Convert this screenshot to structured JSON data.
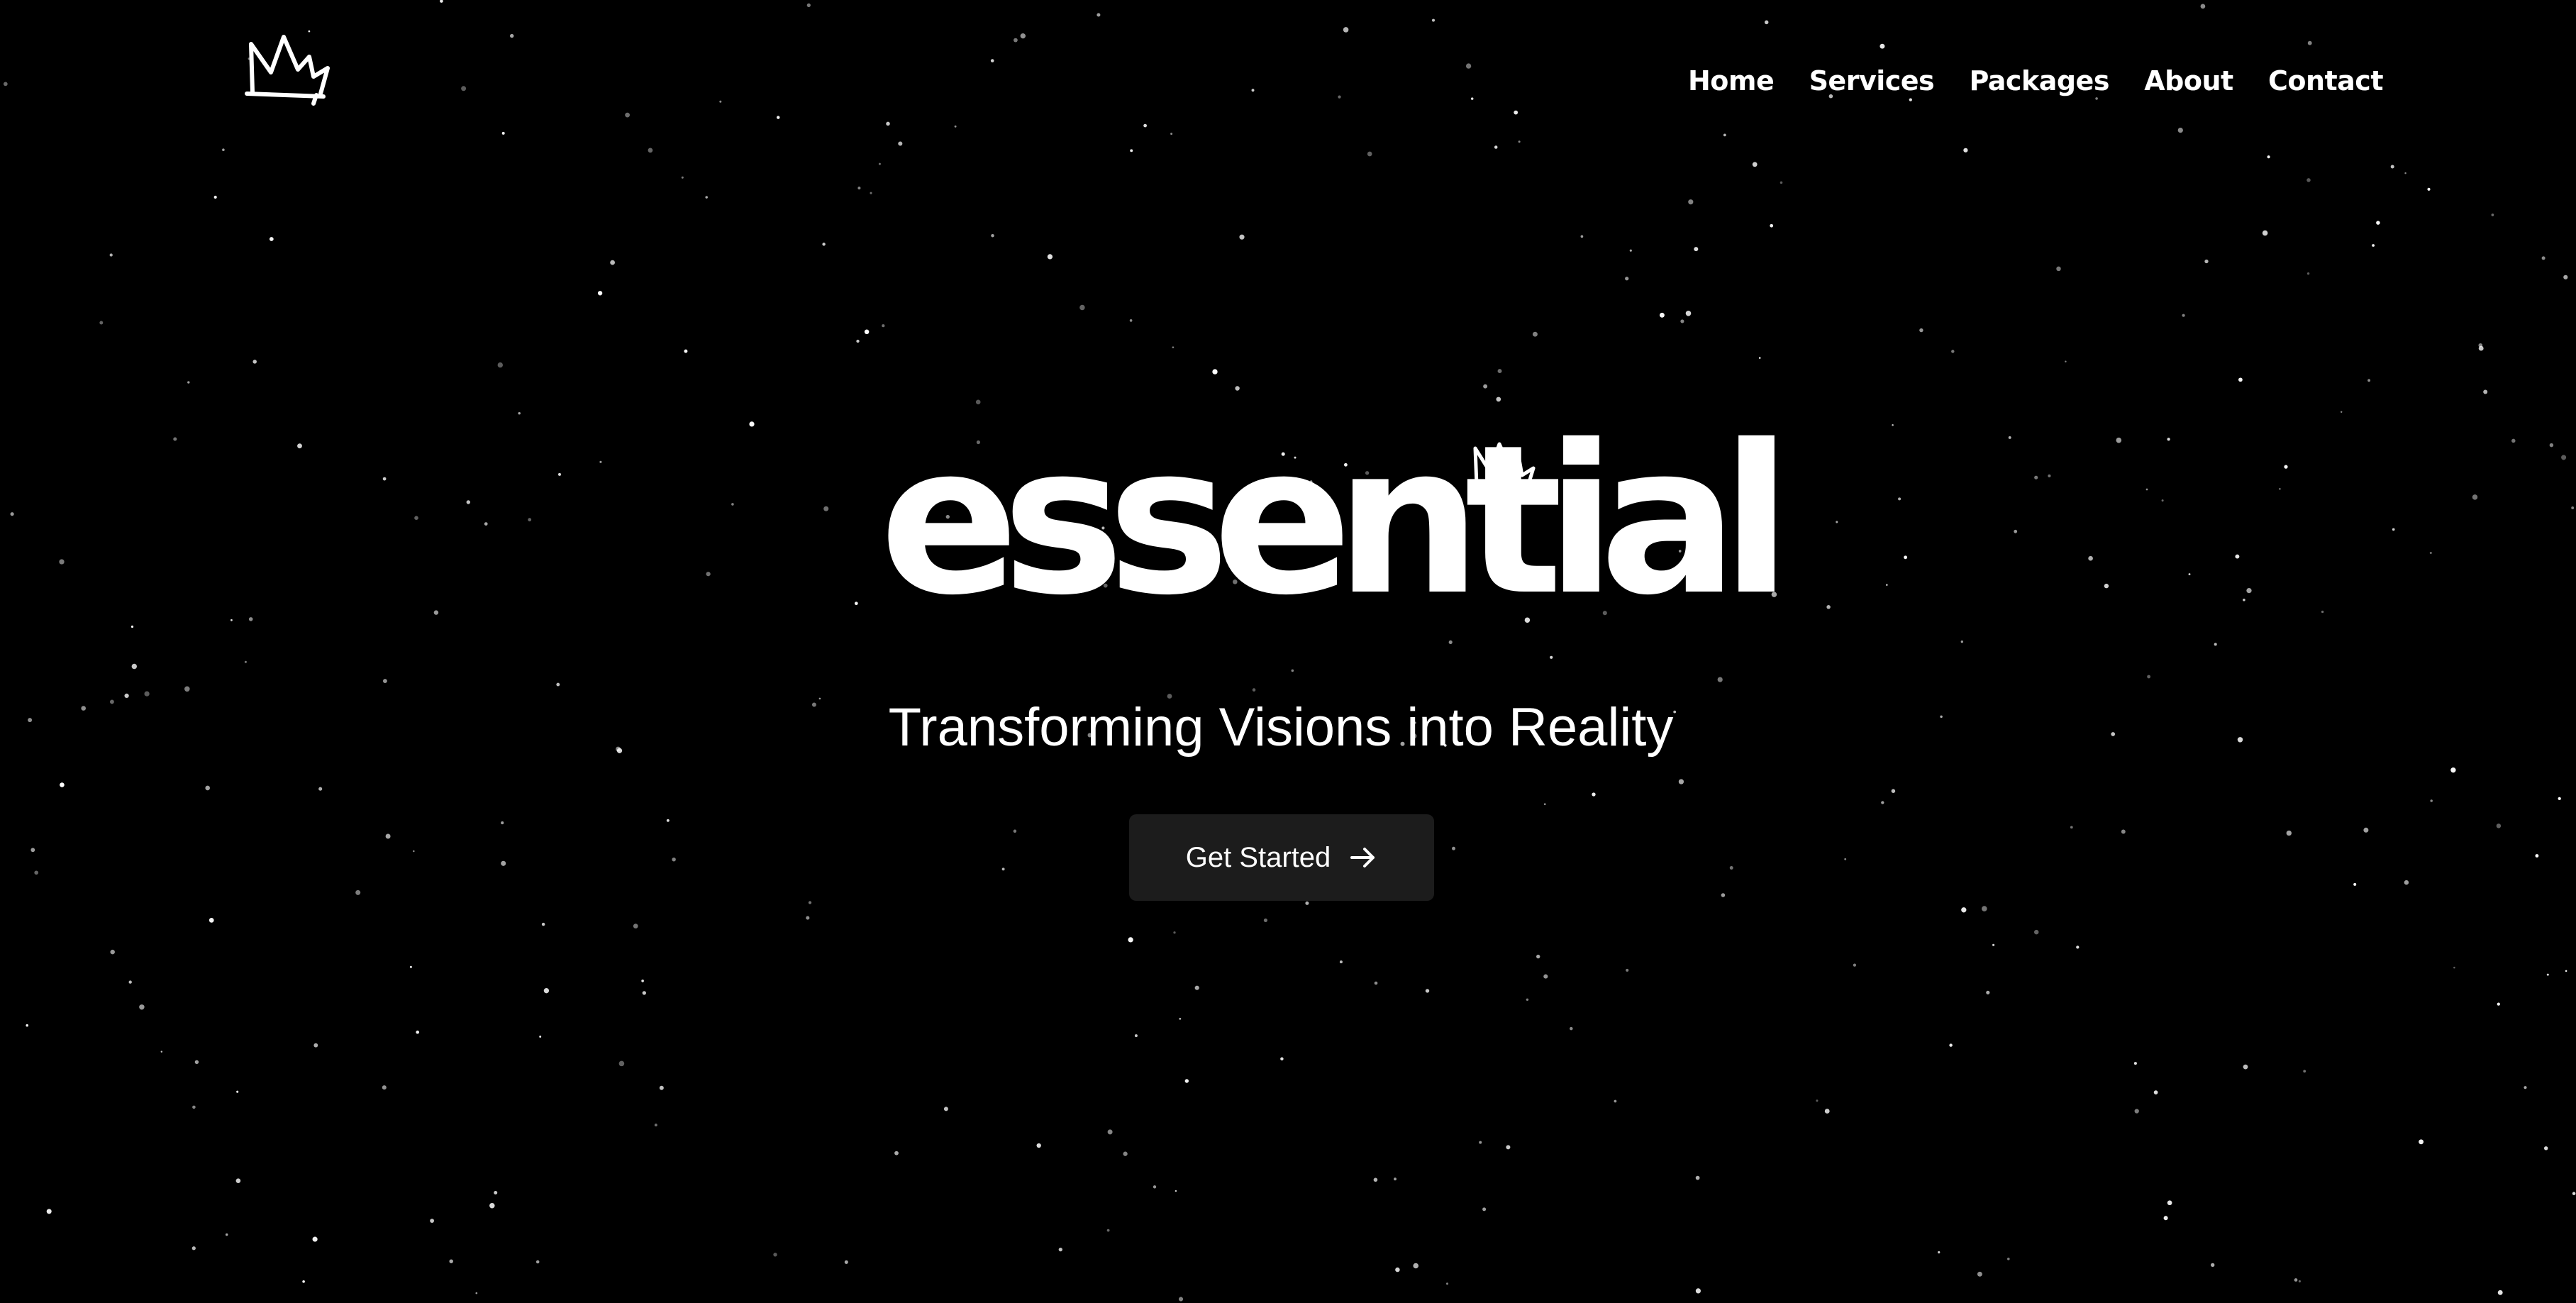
{
  "header": {
    "logo_icon": "crown-icon",
    "nav": [
      {
        "label": "Home"
      },
      {
        "label": "Services"
      },
      {
        "label": "Packages"
      },
      {
        "label": "About"
      },
      {
        "label": "Contact"
      }
    ]
  },
  "hero": {
    "brand_wordmark": "essential",
    "brand_icon": "crown-icon",
    "tagline": "Transforming Visions into Reality",
    "cta_label": "Get Started",
    "cta_icon": "arrow-right-icon"
  },
  "theme": {
    "background": "#000000",
    "text": "#ffffff",
    "button_background": "#1c1c1c",
    "star": "#ffffff"
  }
}
